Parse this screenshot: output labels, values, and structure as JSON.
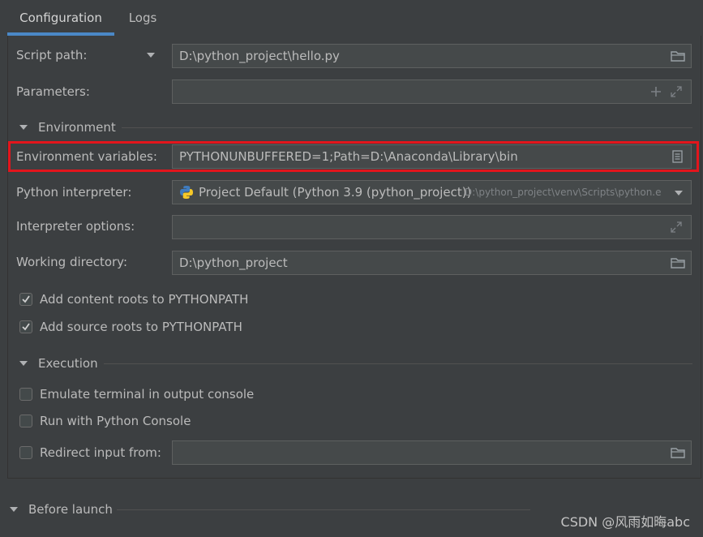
{
  "tabs": [
    {
      "label": "Configuration",
      "active": true
    },
    {
      "label": "Logs",
      "active": false
    }
  ],
  "form": {
    "script_path": {
      "label": "Script path:",
      "value": "D:\\python_project\\hello.py"
    },
    "parameters": {
      "label": "Parameters:",
      "value": ""
    },
    "environment_section": "Environment",
    "env_vars": {
      "label": "Environment variables:",
      "value": "PYTHONUNBUFFERED=1;Path=D:\\Anaconda\\Library\\bin"
    },
    "interpreter": {
      "label": "Python interpreter:",
      "value": "Project Default (Python 3.9 (python_project))",
      "path": "D:\\python_project\\venv\\Scripts\\python.e"
    },
    "interpreter_options": {
      "label": "Interpreter options:",
      "value": ""
    },
    "working_dir": {
      "label": "Working directory:",
      "value": "D:\\python_project"
    },
    "add_content_roots": {
      "label": "Add content roots to PYTHONPATH",
      "checked": true
    },
    "add_source_roots": {
      "label": "Add source roots to PYTHONPATH",
      "checked": true
    },
    "execution_section": "Execution",
    "emulate_terminal": {
      "label": "Emulate terminal in output console",
      "checked": false
    },
    "run_python_console": {
      "label": "Run with Python Console",
      "checked": false
    },
    "redirect_input": {
      "label": "Redirect input from:",
      "checked": false,
      "value": ""
    }
  },
  "before_launch": "Before launch",
  "watermark": "CSDN @风雨如晦abc",
  "colors": {
    "background": "#3c3f41",
    "field_bg": "#45494a",
    "accent": "#4a88c7",
    "highlight": "#e3151c"
  },
  "icons": [
    "chevron-down-icon",
    "folder-icon",
    "plus-icon",
    "expand-icon",
    "document-icon",
    "python-logo-icon",
    "checkmark-icon"
  ]
}
